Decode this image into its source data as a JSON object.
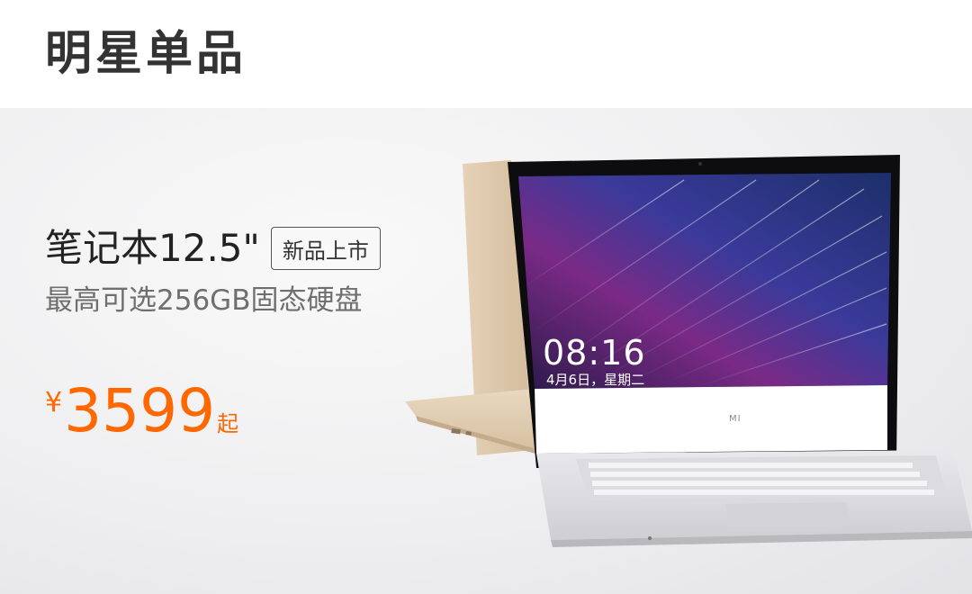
{
  "section": {
    "title": "明星单品"
  },
  "product": {
    "name": "笔记本12.5\"",
    "badge": "新品上市",
    "subtitle": "最高可选256GB固态硬盘",
    "price": {
      "currency": "¥",
      "value": "3599",
      "suffix": "起"
    },
    "screen": {
      "time": "08:16",
      "date": "4月6日，星期二"
    },
    "brand_mark": "MI"
  },
  "colors": {
    "price": "#ff6700",
    "title": "#333333",
    "subtitle": "#6f6f6f"
  }
}
